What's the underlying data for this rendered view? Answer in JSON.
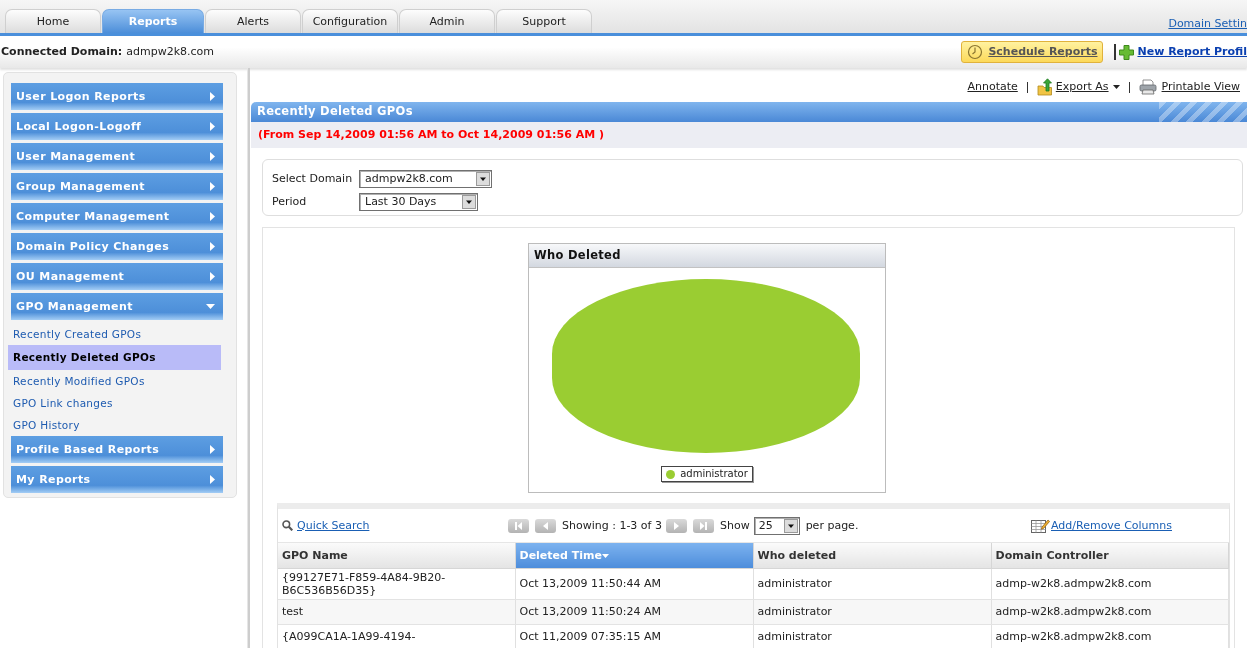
{
  "top_nav": {
    "tabs": [
      {
        "label": "Home",
        "selected": false
      },
      {
        "label": "Reports",
        "selected": true
      },
      {
        "label": "Alerts",
        "selected": false
      },
      {
        "label": "Configuration",
        "selected": false
      },
      {
        "label": "Admin",
        "selected": false
      },
      {
        "label": "Support",
        "selected": false
      }
    ],
    "domain_settings_link": "Domain Settin"
  },
  "domain_bar": {
    "label": "Connected Domain:",
    "value": "admpw2k8.com",
    "schedule_button": "Schedule Reports",
    "new_profile_link": "New Report Profil"
  },
  "sidebar": {
    "items": [
      {
        "label": "User Logon Reports",
        "expanded": false
      },
      {
        "label": "Local Logon-Logoff",
        "expanded": false
      },
      {
        "label": "User Management",
        "expanded": false
      },
      {
        "label": "Group Management",
        "expanded": false
      },
      {
        "label": "Computer Management",
        "expanded": false
      },
      {
        "label": "Domain Policy Changes",
        "expanded": false
      },
      {
        "label": "OU Management",
        "expanded": false
      },
      {
        "label": "GPO Management",
        "expanded": true,
        "children": [
          {
            "label": "Recently Created GPOs",
            "selected": false
          },
          {
            "label": "Recently Deleted GPOs",
            "selected": true
          },
          {
            "label": "Recently Modified GPOs",
            "selected": false
          },
          {
            "label": "GPO Link changes",
            "selected": false
          },
          {
            "label": "GPO History",
            "selected": false
          }
        ]
      },
      {
        "label": "Profile Based Reports",
        "expanded": false
      },
      {
        "label": "My Reports",
        "expanded": false
      }
    ]
  },
  "toolbar": {
    "annotate": "Annotate",
    "export": "Export As",
    "print": "Printable View"
  },
  "report": {
    "title": "Recently Deleted GPOs",
    "date_range": "(From Sep 14,2009 01:56 AM to Oct 14,2009 01:56 AM )",
    "filters": [
      {
        "label": "Select Domain",
        "value": "admpw2k8.com"
      },
      {
        "label": "Period",
        "value": "Last 30 Days"
      }
    ]
  },
  "chart": {
    "title": "Who Deleted",
    "legend": [
      {
        "label": "administrator",
        "color": "#9acd32"
      }
    ]
  },
  "table": {
    "quick_search": "Quick Search",
    "paging": "Showing : 1-3 of 3",
    "show_label": "Show",
    "page_size": "25",
    "per_page": "per page.",
    "columns_link": "Add/Remove Columns",
    "columns": [
      {
        "label": "GPO Name",
        "sorted": false
      },
      {
        "label": "Deleted Time",
        "sorted": true
      },
      {
        "label": "Who deleted",
        "sorted": false
      },
      {
        "label": "Domain Controller",
        "sorted": false
      }
    ],
    "rows": [
      [
        "{99127E71-F859-4A84-9B20-B6C536B56D35}",
        "Oct 13,2009 11:50:44 AM",
        "administrator",
        "admp-w2k8.admpw2k8.com"
      ],
      [
        "test",
        "Oct 13,2009 11:50:24 AM",
        "administrator",
        "admp-w2k8.admpw2k8.com"
      ],
      [
        "{A099CA1A-1A99-4194-",
        "Oct 11,2009 07:35:15 AM",
        "administrator",
        "admp-w2k8.admpw2k8.com"
      ]
    ]
  }
}
